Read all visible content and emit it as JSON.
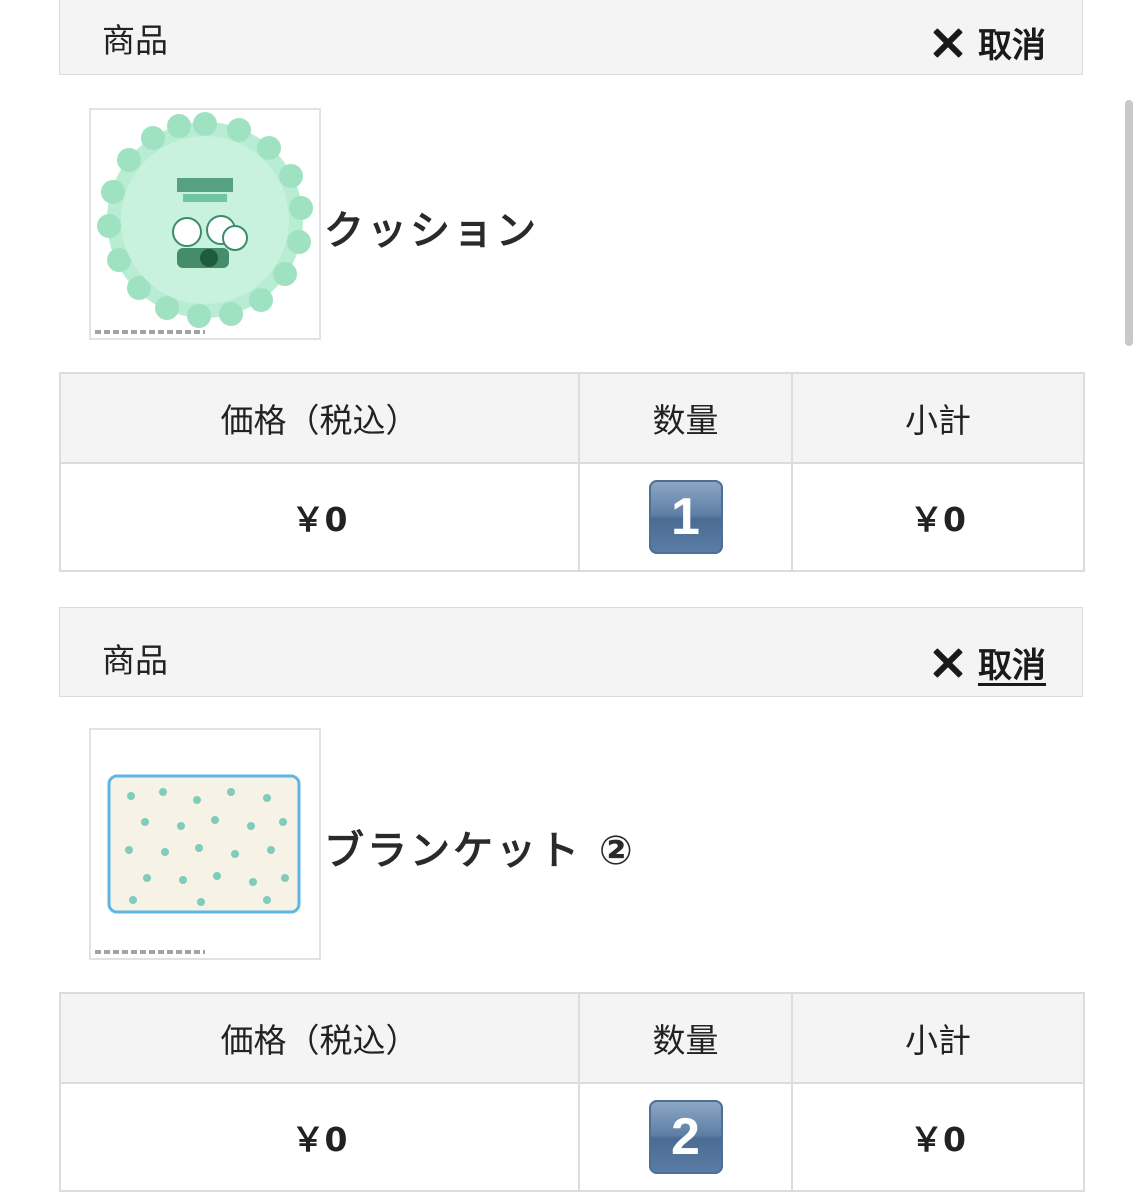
{
  "items": [
    {
      "header_label": "商品",
      "cancel_label": "取消",
      "product_name": "クッション",
      "image_icon": "cushion-image",
      "table": {
        "headers": [
          "価格（税込）",
          "数量",
          "小計"
        ],
        "price": "￥0",
        "quantity": "1",
        "subtotal": "￥0"
      }
    },
    {
      "header_label": "商品",
      "cancel_label": "取消",
      "product_name": "ブランケット ②",
      "image_icon": "blanket-image",
      "table": {
        "headers": [
          "価格（税込）",
          "数量",
          "小計"
        ],
        "price": "￥0",
        "quantity": "2",
        "subtotal": "￥0"
      }
    }
  ],
  "colors": {
    "header_bg": "#f4f4f4",
    "border": "#dcdcdc",
    "qty_badge": "#5d7ea4",
    "cushion_green": "#9fe6c4"
  }
}
